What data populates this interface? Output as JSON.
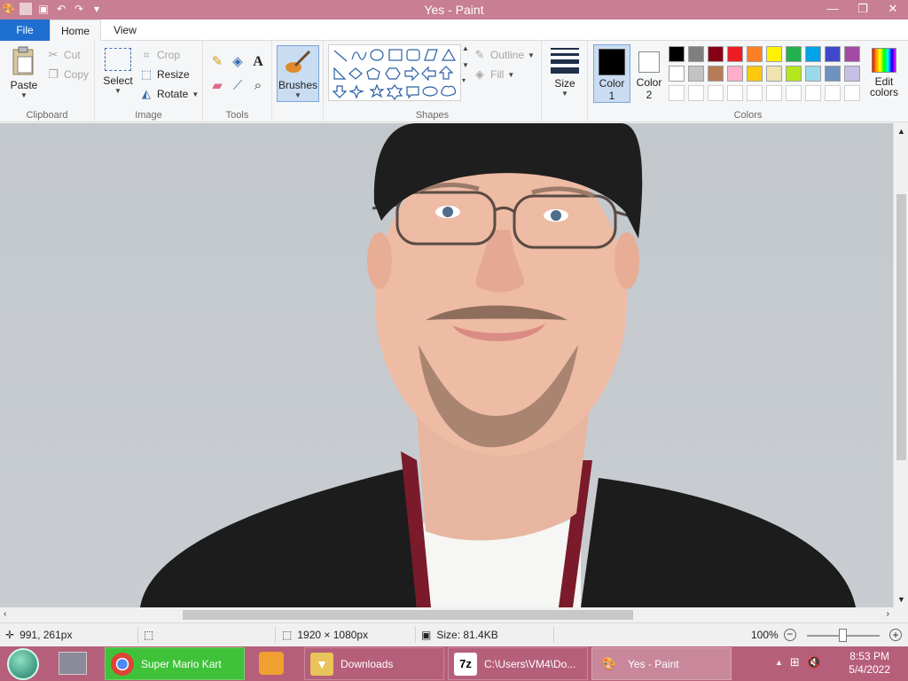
{
  "window": {
    "title": "Yes - Paint",
    "minimize_label": "—",
    "restore_label": "❐",
    "close_label": "✕"
  },
  "tabs": {
    "file": "File",
    "home": "Home",
    "view": "View"
  },
  "ribbon": {
    "clipboard": {
      "label": "Clipboard",
      "paste": "Paste",
      "cut": "Cut",
      "copy": "Copy"
    },
    "image": {
      "label": "Image",
      "select": "Select",
      "crop": "Crop",
      "resize": "Resize",
      "rotate": "Rotate"
    },
    "tools": {
      "label": "Tools"
    },
    "brushes": {
      "label": "Brushes"
    },
    "shapes": {
      "label": "Shapes",
      "outline": "Outline",
      "fill": "Fill"
    },
    "size": {
      "label": "Size"
    },
    "colors": {
      "label": "Colors",
      "color1": "Color",
      "color1_num": "1",
      "color2": "Color",
      "color2_num": "2",
      "edit": "Edit colors",
      "color1_value": "#000000",
      "color2_value": "#ffffff",
      "palette_row1": [
        "#000000",
        "#7f7f7f",
        "#880015",
        "#ed1c24",
        "#ff7f27",
        "#fff200",
        "#22b14c",
        "#00a2e8",
        "#3f48cc",
        "#a349a4"
      ],
      "palette_row2": [
        "#ffffff",
        "#c3c3c3",
        "#b97a57",
        "#ffaec9",
        "#ffc90e",
        "#efe4b0",
        "#b5e61d",
        "#99d9ea",
        "#7092be",
        "#c8bfe7"
      ]
    }
  },
  "status": {
    "cursor_pos": "991, 261px",
    "dimensions": "1920 × 1080px",
    "size": "Size: 81.4KB",
    "zoom": "100%"
  },
  "taskbar": {
    "items": [
      {
        "label": "Super Mario Kart",
        "icon": "chrome-icon"
      },
      {
        "label": "Downloads",
        "icon": "folder-icon"
      },
      {
        "label": "C:\\Users\\VM4\\Do...",
        "icon": "7zip-icon"
      },
      {
        "label": "Yes - Paint",
        "icon": "paint-icon"
      }
    ],
    "time": "8:53 PM",
    "date": "5/4/2022"
  }
}
